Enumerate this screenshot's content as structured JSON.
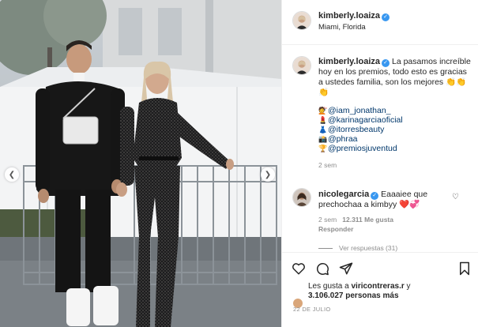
{
  "post": {
    "author": "kimberly.loaiza",
    "location": "Miami, Florida"
  },
  "caption": {
    "username": "kimberly.loaiza",
    "text": "La pasamos increíble hoy en los premios, todo esto es gracias a ustedes familia, son los mejores 👏👏👏",
    "mentions": [
      {
        "emoji": "💇",
        "handle": "@iam_jonathan_"
      },
      {
        "emoji": "💄",
        "handle": "@karinagarciaoficial"
      },
      {
        "emoji": "👗",
        "handle": "@itorresbeauty"
      },
      {
        "emoji": "📸",
        "handle": "@phraa"
      },
      {
        "emoji": "🏆",
        "handle": "@premiosjuventud"
      }
    ],
    "time": "2 sem"
  },
  "comment": {
    "username": "nicolegarcia",
    "text": "Eaaaiee que prechochaa a kimbyy",
    "hearts": "❤️💞",
    "time": "2 sem",
    "likes": "12.311 Me gusta",
    "reply": "Responder",
    "view_replies": "Ver respuestas (31)"
  },
  "likes": {
    "prefix": "Les gusta a ",
    "user": "viricontreras.r",
    "conjunction": " y",
    "count": "3.106.027 personas más"
  },
  "date": "22 DE JULIO",
  "icons": {
    "like": "heart-outline-icon",
    "comment": "comment-icon",
    "share": "send-icon",
    "save": "bookmark-icon",
    "prev": "chevron-left-icon",
    "next": "chevron-right-icon"
  },
  "colors": {
    "verified": "#3897f0",
    "mention": "#00376b",
    "muted": "#8e8e8e",
    "border": "#efefef"
  }
}
